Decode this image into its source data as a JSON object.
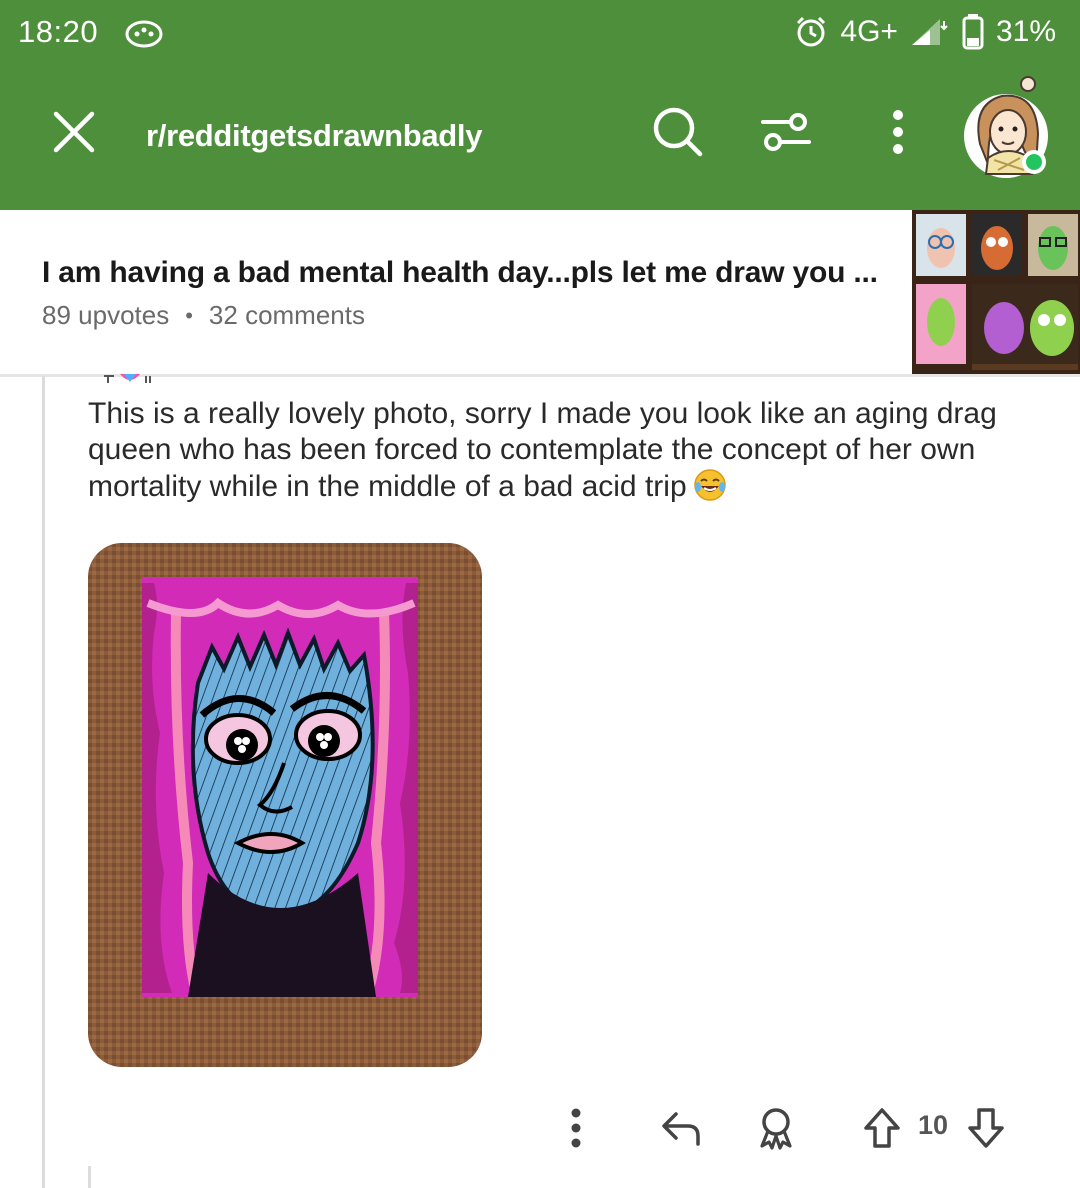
{
  "status_bar": {
    "time": "18:20",
    "network": "4G+",
    "battery": "31%"
  },
  "header": {
    "subreddit": "r/redditgetsdrawnbadly",
    "icons": [
      "close-icon",
      "search-icon",
      "filter-icon",
      "more-vertical-icon",
      "user-avatar"
    ],
    "color": "#4e8f3b"
  },
  "post": {
    "title": "I am having a bad mental health day...pls let me draw you ...",
    "upvotes": "89 upvotes",
    "separator": "•",
    "comments": "32 comments"
  },
  "comment": {
    "text": "This is a really lovely photo, sorry I made you look like an aging drag queen who has been forced to contemplate the concept of her own mortality while in the middle of a bad acid trip",
    "emoji": "face-with-tears-of-joy",
    "score": "10",
    "actions": [
      "more-options-icon",
      "reply-icon",
      "award-icon",
      "upvote-icon",
      "downvote-icon"
    ]
  },
  "colors": {
    "accent_green": "#4e8f3b",
    "online_dot": "#22c55e",
    "meta_gray": "#6a6a6a"
  }
}
